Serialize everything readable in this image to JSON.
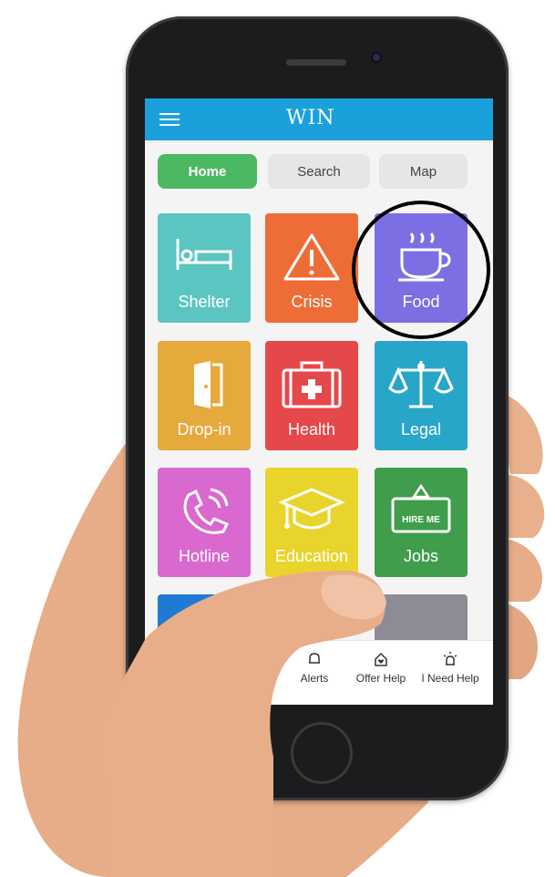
{
  "colors": {
    "appbar": "#1aa1db",
    "home_tab": "#4cb962",
    "shelter": "#5bc5c1",
    "crisis": "#ee6d36",
    "food": "#7b6fe3",
    "dropin": "#e6a93c",
    "health": "#e5484a",
    "legal": "#28a6c9",
    "hotline": "#d968cf",
    "education": "#e9d42c",
    "jobs": "#3f9d4c"
  },
  "appbar": {
    "logo": "WIN",
    "menu_icon": "hamburger-menu-icon"
  },
  "tabs": [
    {
      "label": "Home"
    },
    {
      "label": "Search"
    },
    {
      "label": "Map"
    }
  ],
  "tiles": [
    {
      "label": "Shelter",
      "icon": "bed-icon"
    },
    {
      "label": "Crisis",
      "icon": "warning-icon"
    },
    {
      "label": "Food",
      "icon": "coffee-cup-icon"
    },
    {
      "label": "Drop-in",
      "icon": "door-icon"
    },
    {
      "label": "Health",
      "icon": "first-aid-kit-icon"
    },
    {
      "label": "Legal",
      "icon": "scales-icon"
    },
    {
      "label": "Hotline",
      "icon": "phone-icon"
    },
    {
      "label": "Education",
      "icon": "graduation-cap-icon"
    },
    {
      "label": "Jobs",
      "icon": "hire-me-sign-icon",
      "sign_text": "HIRE ME"
    }
  ],
  "bottom_nav": [
    {
      "label": "Alerts",
      "icon": "bell-icon"
    },
    {
      "label": "Offer Help",
      "icon": "house-heart-icon"
    },
    {
      "label": "I Need Help",
      "icon": "siren-icon"
    }
  ]
}
